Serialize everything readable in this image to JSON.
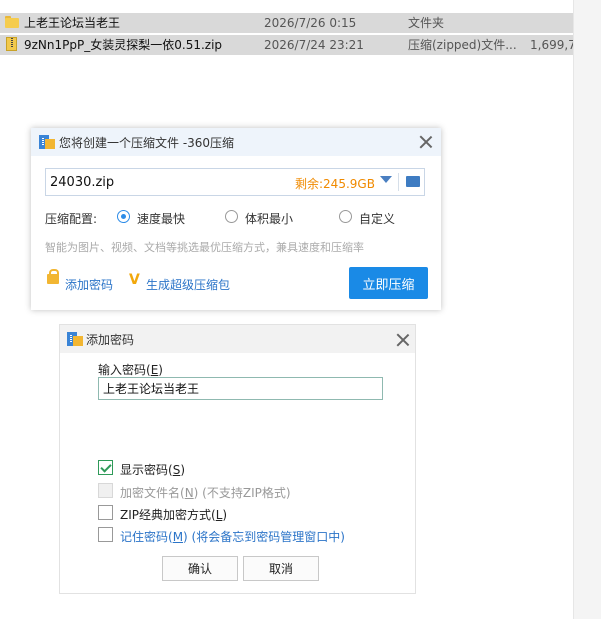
{
  "file_list": {
    "rows": [
      {
        "icon": "folder-icon",
        "name": "上老王论坛当老王",
        "date": "2026/7/26 0:15",
        "type": "文件夹",
        "size": ""
      },
      {
        "icon": "zip-icon",
        "name": "9zNn1PpP_女装灵探梨一依0.51.zip",
        "date": "2026/7/24 23:21",
        "type": "压缩(zipped)文件...",
        "size": "1,699,70"
      }
    ]
  },
  "compress_dialog": {
    "title": "您将创建一个压缩文件 -360压缩",
    "filename": "24030.zip",
    "free_space": "剩余:245.9GB",
    "config_label": "压缩配置:",
    "options": [
      "速度最快",
      "体积最小",
      "自定义"
    ],
    "selected_option": "速度最快",
    "hint": "智能为图片、视频、文档等挑选最优压缩方式，兼具速度和压缩率",
    "add_password": "添加密码",
    "super_pack": "生成超级压缩包",
    "compress_button": "立即压缩",
    "colors": {
      "accent": "#1a8ae6",
      "free_space": "#f08a00",
      "link": "#2b74c8"
    }
  },
  "password_dialog": {
    "title": "添加密码",
    "input_label": "输入密码(",
    "input_label_key": "E",
    "input_label_end": ")",
    "password_value": "上老王论坛当老王",
    "show_password": {
      "label": "显示密码(",
      "key": "S",
      "end": ")",
      "checked": true
    },
    "encrypt_filename": {
      "label": "加密文件名(",
      "key": "N",
      "end": ") (不支持ZIP格式)",
      "checked": false,
      "disabled": true
    },
    "zip_classic": {
      "label": "ZIP经典加密方式(",
      "key": "L",
      "end": ")",
      "checked": false
    },
    "remember": {
      "label": "记住密码(",
      "key": "M",
      "end": ") (将会备忘到密码管理窗口中)",
      "checked": false
    },
    "ok_button": "确认",
    "cancel_button": "取消"
  }
}
